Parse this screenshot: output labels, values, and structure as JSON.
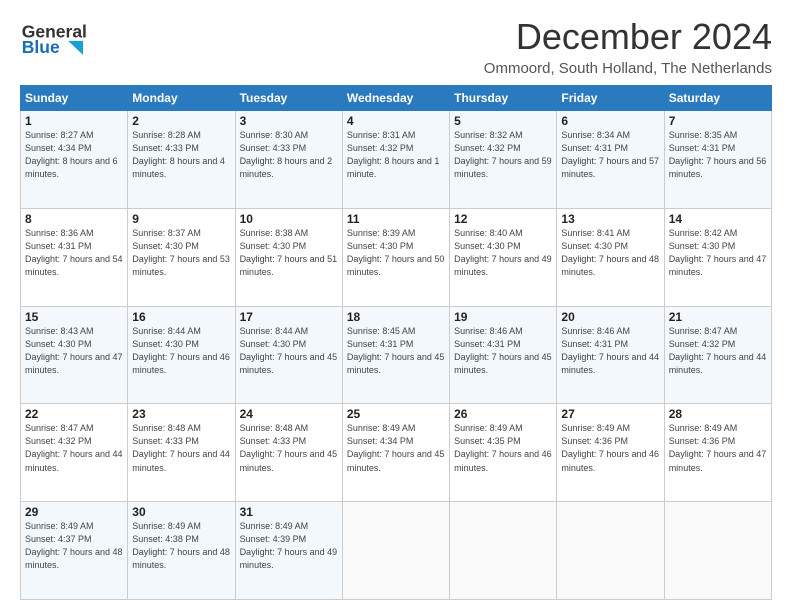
{
  "header": {
    "logo_line1": "General",
    "logo_line2": "Blue",
    "month_title": "December 2024",
    "subtitle": "Ommoord, South Holland, The Netherlands"
  },
  "days_of_week": [
    "Sunday",
    "Monday",
    "Tuesday",
    "Wednesday",
    "Thursday",
    "Friday",
    "Saturday"
  ],
  "weeks": [
    [
      {
        "day": "1",
        "sunrise": "Sunrise: 8:27 AM",
        "sunset": "Sunset: 4:34 PM",
        "daylight": "Daylight: 8 hours and 6 minutes."
      },
      {
        "day": "2",
        "sunrise": "Sunrise: 8:28 AM",
        "sunset": "Sunset: 4:33 PM",
        "daylight": "Daylight: 8 hours and 4 minutes."
      },
      {
        "day": "3",
        "sunrise": "Sunrise: 8:30 AM",
        "sunset": "Sunset: 4:33 PM",
        "daylight": "Daylight: 8 hours and 2 minutes."
      },
      {
        "day": "4",
        "sunrise": "Sunrise: 8:31 AM",
        "sunset": "Sunset: 4:32 PM",
        "daylight": "Daylight: 8 hours and 1 minute."
      },
      {
        "day": "5",
        "sunrise": "Sunrise: 8:32 AM",
        "sunset": "Sunset: 4:32 PM",
        "daylight": "Daylight: 7 hours and 59 minutes."
      },
      {
        "day": "6",
        "sunrise": "Sunrise: 8:34 AM",
        "sunset": "Sunset: 4:31 PM",
        "daylight": "Daylight: 7 hours and 57 minutes."
      },
      {
        "day": "7",
        "sunrise": "Sunrise: 8:35 AM",
        "sunset": "Sunset: 4:31 PM",
        "daylight": "Daylight: 7 hours and 56 minutes."
      }
    ],
    [
      {
        "day": "8",
        "sunrise": "Sunrise: 8:36 AM",
        "sunset": "Sunset: 4:31 PM",
        "daylight": "Daylight: 7 hours and 54 minutes."
      },
      {
        "day": "9",
        "sunrise": "Sunrise: 8:37 AM",
        "sunset": "Sunset: 4:30 PM",
        "daylight": "Daylight: 7 hours and 53 minutes."
      },
      {
        "day": "10",
        "sunrise": "Sunrise: 8:38 AM",
        "sunset": "Sunset: 4:30 PM",
        "daylight": "Daylight: 7 hours and 51 minutes."
      },
      {
        "day": "11",
        "sunrise": "Sunrise: 8:39 AM",
        "sunset": "Sunset: 4:30 PM",
        "daylight": "Daylight: 7 hours and 50 minutes."
      },
      {
        "day": "12",
        "sunrise": "Sunrise: 8:40 AM",
        "sunset": "Sunset: 4:30 PM",
        "daylight": "Daylight: 7 hours and 49 minutes."
      },
      {
        "day": "13",
        "sunrise": "Sunrise: 8:41 AM",
        "sunset": "Sunset: 4:30 PM",
        "daylight": "Daylight: 7 hours and 48 minutes."
      },
      {
        "day": "14",
        "sunrise": "Sunrise: 8:42 AM",
        "sunset": "Sunset: 4:30 PM",
        "daylight": "Daylight: 7 hours and 47 minutes."
      }
    ],
    [
      {
        "day": "15",
        "sunrise": "Sunrise: 8:43 AM",
        "sunset": "Sunset: 4:30 PM",
        "daylight": "Daylight: 7 hours and 47 minutes."
      },
      {
        "day": "16",
        "sunrise": "Sunrise: 8:44 AM",
        "sunset": "Sunset: 4:30 PM",
        "daylight": "Daylight: 7 hours and 46 minutes."
      },
      {
        "day": "17",
        "sunrise": "Sunrise: 8:44 AM",
        "sunset": "Sunset: 4:30 PM",
        "daylight": "Daylight: 7 hours and 45 minutes."
      },
      {
        "day": "18",
        "sunrise": "Sunrise: 8:45 AM",
        "sunset": "Sunset: 4:31 PM",
        "daylight": "Daylight: 7 hours and 45 minutes."
      },
      {
        "day": "19",
        "sunrise": "Sunrise: 8:46 AM",
        "sunset": "Sunset: 4:31 PM",
        "daylight": "Daylight: 7 hours and 45 minutes."
      },
      {
        "day": "20",
        "sunrise": "Sunrise: 8:46 AM",
        "sunset": "Sunset: 4:31 PM",
        "daylight": "Daylight: 7 hours and 44 minutes."
      },
      {
        "day": "21",
        "sunrise": "Sunrise: 8:47 AM",
        "sunset": "Sunset: 4:32 PM",
        "daylight": "Daylight: 7 hours and 44 minutes."
      }
    ],
    [
      {
        "day": "22",
        "sunrise": "Sunrise: 8:47 AM",
        "sunset": "Sunset: 4:32 PM",
        "daylight": "Daylight: 7 hours and 44 minutes."
      },
      {
        "day": "23",
        "sunrise": "Sunrise: 8:48 AM",
        "sunset": "Sunset: 4:33 PM",
        "daylight": "Daylight: 7 hours and 44 minutes."
      },
      {
        "day": "24",
        "sunrise": "Sunrise: 8:48 AM",
        "sunset": "Sunset: 4:33 PM",
        "daylight": "Daylight: 7 hours and 45 minutes."
      },
      {
        "day": "25",
        "sunrise": "Sunrise: 8:49 AM",
        "sunset": "Sunset: 4:34 PM",
        "daylight": "Daylight: 7 hours and 45 minutes."
      },
      {
        "day": "26",
        "sunrise": "Sunrise: 8:49 AM",
        "sunset": "Sunset: 4:35 PM",
        "daylight": "Daylight: 7 hours and 46 minutes."
      },
      {
        "day": "27",
        "sunrise": "Sunrise: 8:49 AM",
        "sunset": "Sunset: 4:36 PM",
        "daylight": "Daylight: 7 hours and 46 minutes."
      },
      {
        "day": "28",
        "sunrise": "Sunrise: 8:49 AM",
        "sunset": "Sunset: 4:36 PM",
        "daylight": "Daylight: 7 hours and 47 minutes."
      }
    ],
    [
      {
        "day": "29",
        "sunrise": "Sunrise: 8:49 AM",
        "sunset": "Sunset: 4:37 PM",
        "daylight": "Daylight: 7 hours and 48 minutes."
      },
      {
        "day": "30",
        "sunrise": "Sunrise: 8:49 AM",
        "sunset": "Sunset: 4:38 PM",
        "daylight": "Daylight: 7 hours and 48 minutes."
      },
      {
        "day": "31",
        "sunrise": "Sunrise: 8:49 AM",
        "sunset": "Sunset: 4:39 PM",
        "daylight": "Daylight: 7 hours and 49 minutes."
      },
      null,
      null,
      null,
      null
    ]
  ]
}
